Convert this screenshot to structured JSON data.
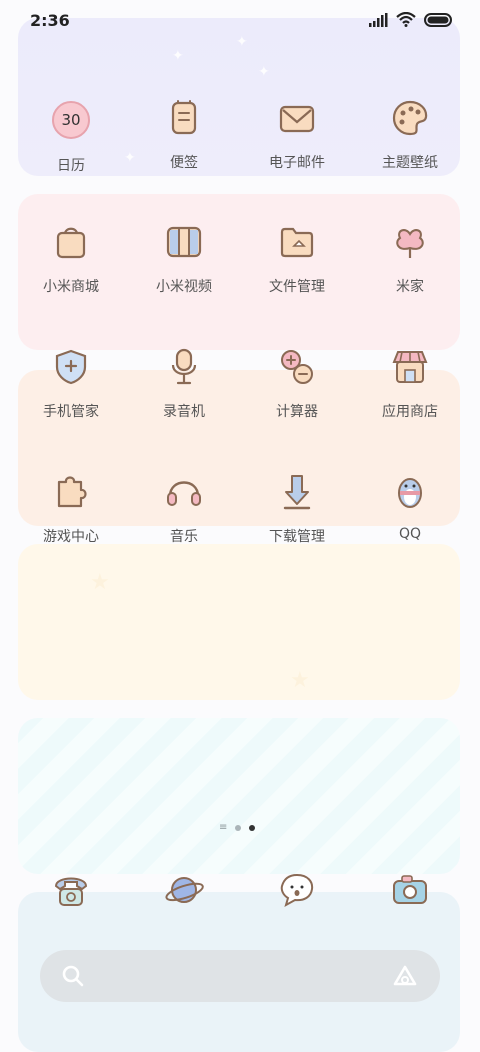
{
  "status_bar": {
    "time": "2:36"
  },
  "apps": [
    {
      "name": "日历",
      "badge": "30"
    },
    {
      "name": "便签"
    },
    {
      "name": "电子邮件"
    },
    {
      "name": "主题壁纸"
    },
    {
      "name": "小米商城"
    },
    {
      "name": "小米视频"
    },
    {
      "name": "文件管理"
    },
    {
      "name": "米家"
    },
    {
      "name": "手机管家"
    },
    {
      "name": "录音机"
    },
    {
      "name": "计算器"
    },
    {
      "name": "应用商店"
    },
    {
      "name": "游戏中心"
    },
    {
      "name": "音乐"
    },
    {
      "name": "下载管理"
    },
    {
      "name": "QQ"
    }
  ],
  "dock": [
    "phone-icon",
    "planet-browser-icon",
    "chat-bubble-icon",
    "camera-icon"
  ],
  "page_indicator": {
    "pages": 2,
    "active": 2
  },
  "colors": {
    "stroke": "#8a6a55",
    "fill_peach": "#f9dcc0",
    "fill_blue": "#b9cdea",
    "fill_pink": "#f4b9c2"
  }
}
